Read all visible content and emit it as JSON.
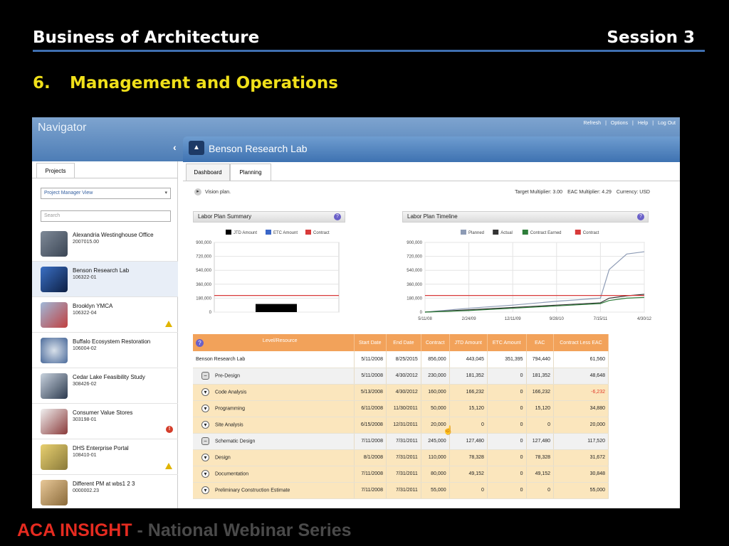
{
  "slide": {
    "header_left": "Business of Architecture",
    "header_right": "Session 3",
    "section_number": "6.",
    "section_title": "Management and Operations",
    "footer_brand": "ACA INSIGHT",
    "footer_rest": " - National Webinar Series"
  },
  "app": {
    "title": "Navigator",
    "top_links": [
      "Refresh",
      "|",
      "Options",
      "|",
      "Help",
      "|",
      "Log Out"
    ],
    "project_title": "Benson Research Lab",
    "left_tab": "Projects",
    "view_select": "Project Manager View",
    "search_placeholder": "Search",
    "projects": [
      {
        "name": "Alexandria Westinghouse Office",
        "number": "2007015.00",
        "flag": "none"
      },
      {
        "name": "Benson Research Lab",
        "number": "106322-01",
        "flag": "none"
      },
      {
        "name": "Brooklyn YMCA",
        "number": "106322-04",
        "flag": "warning"
      },
      {
        "name": "Buffalo Ecosystem Restoration",
        "number": "106004-02",
        "flag": "none"
      },
      {
        "name": "Cedar Lake Feasibility Study",
        "number": "308426-02",
        "flag": "none"
      },
      {
        "name": "Consumer Value Stores",
        "number": "303198-01",
        "flag": "error"
      },
      {
        "name": "DHS Enterprise Portal",
        "number": "108410-01",
        "flag": "warning"
      },
      {
        "name": "Different PM at wbs1 2 3",
        "number": "0000002.23",
        "flag": "none"
      }
    ],
    "main_tabs": [
      "Dashboard",
      "Planning"
    ],
    "vision_label": "Vision plan.",
    "target_multiplier": "Target Multiplier: 3.00",
    "eac_multiplier": "EAC Multiplier: 4.29",
    "currency": "Currency: USD"
  },
  "chart_data": [
    {
      "type": "bar",
      "title": "Labor Plan Summary",
      "legend": [
        "JTD Amount",
        "ETC Amount",
        "Contract"
      ],
      "colors": {
        "JTD Amount": "#000000",
        "ETC Amount": "#3a66c8",
        "Contract": "#d83a3a"
      },
      "y_ticks": [
        "900,000",
        "720,000",
        "540,000",
        "360,000",
        "180,000",
        "0"
      ],
      "ylim": [
        0,
        900000
      ],
      "series": [
        {
          "name": "JTD Amount",
          "values": [
            105000
          ]
        },
        {
          "name": "Contract",
          "values": [
            215000
          ]
        }
      ]
    },
    {
      "type": "line",
      "title": "Labor Plan Timeline",
      "legend": [
        "Planned",
        "Actual",
        "Contract Earned",
        "Contract"
      ],
      "colors": {
        "Planned": "#8d9bb5",
        "Actual": "#333333",
        "Contract Earned": "#2e7d3a",
        "Contract": "#d83a3a"
      },
      "y_ticks": [
        "900,000",
        "720,000",
        "540,000",
        "360,000",
        "180,000",
        "0"
      ],
      "x_ticks": [
        "5/11/08",
        "2/24/09",
        "12/11/09",
        "9/28/10",
        "7/15/11",
        "4/30/12"
      ],
      "ylim": [
        0,
        900000
      ],
      "x": [
        0,
        1,
        2,
        3,
        4,
        4.2,
        4.6,
        5
      ],
      "series": [
        {
          "name": "Planned",
          "values": [
            0,
            50000,
            90000,
            140000,
            180000,
            550000,
            750000,
            780000
          ]
        },
        {
          "name": "Actual",
          "values": [
            0,
            30000,
            60000,
            90000,
            120000,
            180000,
            210000,
            230000
          ]
        },
        {
          "name": "Contract Earned",
          "values": [
            0,
            20000,
            50000,
            80000,
            110000,
            150000,
            180000,
            190000
          ]
        },
        {
          "name": "Contract",
          "values": [
            215000,
            215000,
            215000,
            215000,
            215000,
            215000,
            215000,
            215000
          ]
        }
      ]
    }
  ],
  "table": {
    "headers": [
      "Level/Resource",
      "Start Date",
      "End Date",
      "Contract",
      "JTD Amount",
      "ETC Amount",
      "EAC",
      "Contract Less EAC"
    ],
    "rows": [
      {
        "kind": "top",
        "icon": "",
        "cells": [
          "Benson Research Lab",
          "5/11/2008",
          "8/25/2015",
          "856,000",
          "443,045",
          "351,395",
          "794,440",
          "61,560"
        ]
      },
      {
        "kind": "grp",
        "icon": "−",
        "cells": [
          "Pre-Design",
          "5/11/2008",
          "4/30/2012",
          "230,000",
          "181,352",
          "0",
          "181,352",
          "48,648"
        ]
      },
      {
        "kind": "sub",
        "icon": "▾",
        "cells": [
          "Code Analysis",
          "5/13/2008",
          "4/30/2012",
          "160,000",
          "166,232",
          "0",
          "166,232",
          "-6,232"
        ]
      },
      {
        "kind": "sub",
        "icon": "▾",
        "cells": [
          "Programming",
          "6/11/2008",
          "11/30/2011",
          "50,000",
          "15,120",
          "0",
          "15,120",
          "34,880"
        ]
      },
      {
        "kind": "sub",
        "icon": "▾",
        "cells": [
          "Site Analysis",
          "6/15/2008",
          "12/31/2011",
          "20,000",
          "0",
          "0",
          "0",
          "20,000"
        ]
      },
      {
        "kind": "grp",
        "icon": "−",
        "cells": [
          "Schematic Design",
          "7/11/2008",
          "7/31/2011",
          "245,000",
          "127,480",
          "0",
          "127,480",
          "117,520"
        ]
      },
      {
        "kind": "sub",
        "icon": "▾",
        "cells": [
          "Design",
          "8/1/2008",
          "7/31/2011",
          "110,000",
          "78,328",
          "0",
          "78,328",
          "31,672"
        ]
      },
      {
        "kind": "sub",
        "icon": "▾",
        "cells": [
          "Documentation",
          "7/11/2008",
          "7/31/2011",
          "80,000",
          "49,152",
          "0",
          "49,152",
          "30,848"
        ]
      },
      {
        "kind": "sub",
        "icon": "▾",
        "cells": [
          "Preliminary Construction Estimate",
          "7/11/2008",
          "7/31/2011",
          "55,000",
          "0",
          "0",
          "0",
          "55,000"
        ]
      }
    ]
  }
}
